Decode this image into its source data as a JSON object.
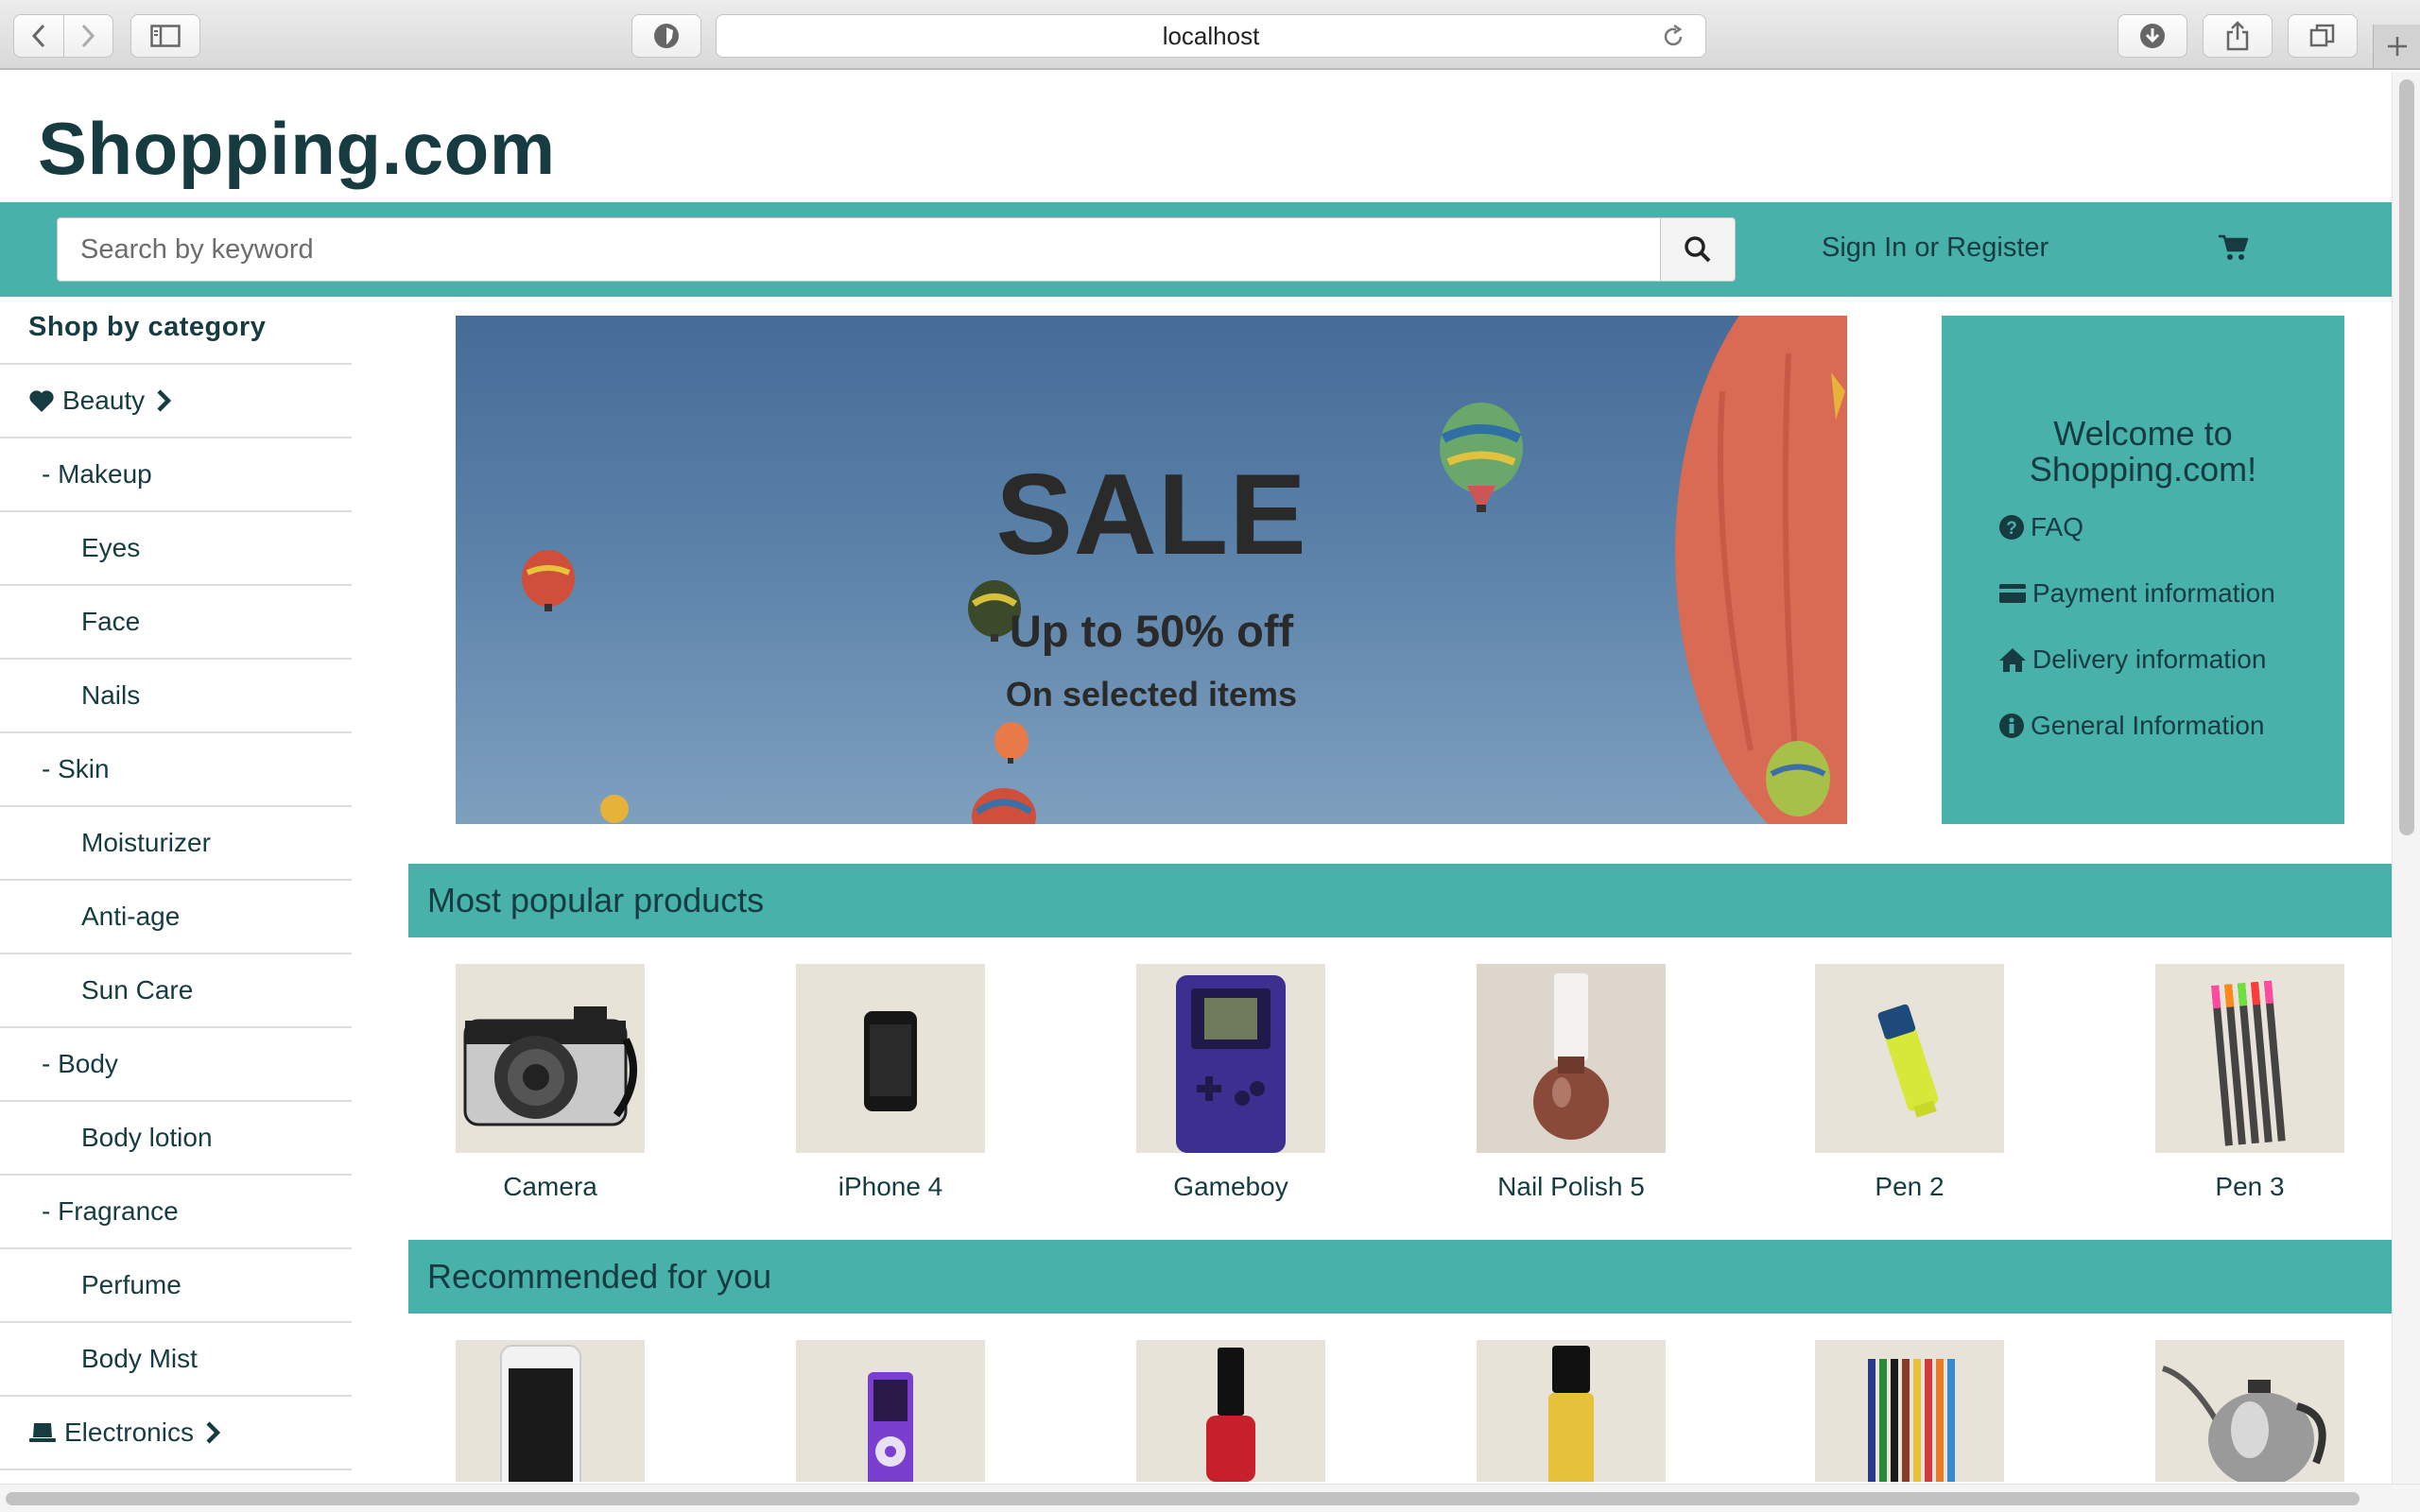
{
  "browser": {
    "url": "localhost",
    "icons": [
      "back-icon",
      "forward-icon",
      "sidebar-icon",
      "shield-icon",
      "reload-icon",
      "download-icon",
      "share-icon",
      "tabs-icon",
      "new-tab-icon"
    ]
  },
  "header": {
    "logo": "Shopping.com",
    "search_placeholder": "Search by keyword",
    "signin": "Sign In or Register",
    "colors": {
      "brand_dark": "#163c42",
      "accent": "#47b1aa"
    }
  },
  "sidebar": {
    "title": "Shop by category",
    "items": [
      {
        "label": "Beauty",
        "level": 0,
        "icon": "heart-icon",
        "chevron": true
      },
      {
        "label": "- Makeup",
        "level": 1
      },
      {
        "label": "Eyes",
        "level": 2
      },
      {
        "label": "Face",
        "level": 2
      },
      {
        "label": "Nails",
        "level": 2
      },
      {
        "label": "- Skin",
        "level": 1
      },
      {
        "label": "Moisturizer",
        "level": 2
      },
      {
        "label": "Anti-age",
        "level": 2
      },
      {
        "label": "Sun Care",
        "level": 2
      },
      {
        "label": "- Body",
        "level": 1
      },
      {
        "label": "Body lotion",
        "level": 2
      },
      {
        "label": "- Fragrance",
        "level": 1
      },
      {
        "label": "Perfume",
        "level": 2
      },
      {
        "label": "Body Mist",
        "level": 2
      },
      {
        "label": "Electronics",
        "level": 0,
        "icon": "laptop-icon",
        "chevron": true
      }
    ]
  },
  "banner": {
    "title": "SALE",
    "subtitle": "Up to 50% off",
    "note": "On selected items"
  },
  "welcome": {
    "title": "Welcome to Shopping.com!",
    "links": [
      {
        "label": "FAQ",
        "icon": "question-circle-icon"
      },
      {
        "label": "Payment information",
        "icon": "credit-card-icon"
      },
      {
        "label": "Delivery information",
        "icon": "home-icon"
      },
      {
        "label": "General Information",
        "icon": "info-circle-icon"
      }
    ]
  },
  "popular": {
    "title": "Most popular products",
    "products": [
      {
        "name": "Camera"
      },
      {
        "name": "iPhone 4"
      },
      {
        "name": "Gameboy"
      },
      {
        "name": "Nail Polish 5"
      },
      {
        "name": "Pen 2"
      },
      {
        "name": "Pen 3"
      }
    ]
  },
  "recommended": {
    "title": "Recommended for you",
    "products": [
      {
        "image": "white-phone"
      },
      {
        "image": "purple-ipod"
      },
      {
        "image": "red-nail-polish"
      },
      {
        "image": "yellow-bottle"
      },
      {
        "image": "colored-pencils"
      },
      {
        "image": "kettle"
      }
    ]
  }
}
